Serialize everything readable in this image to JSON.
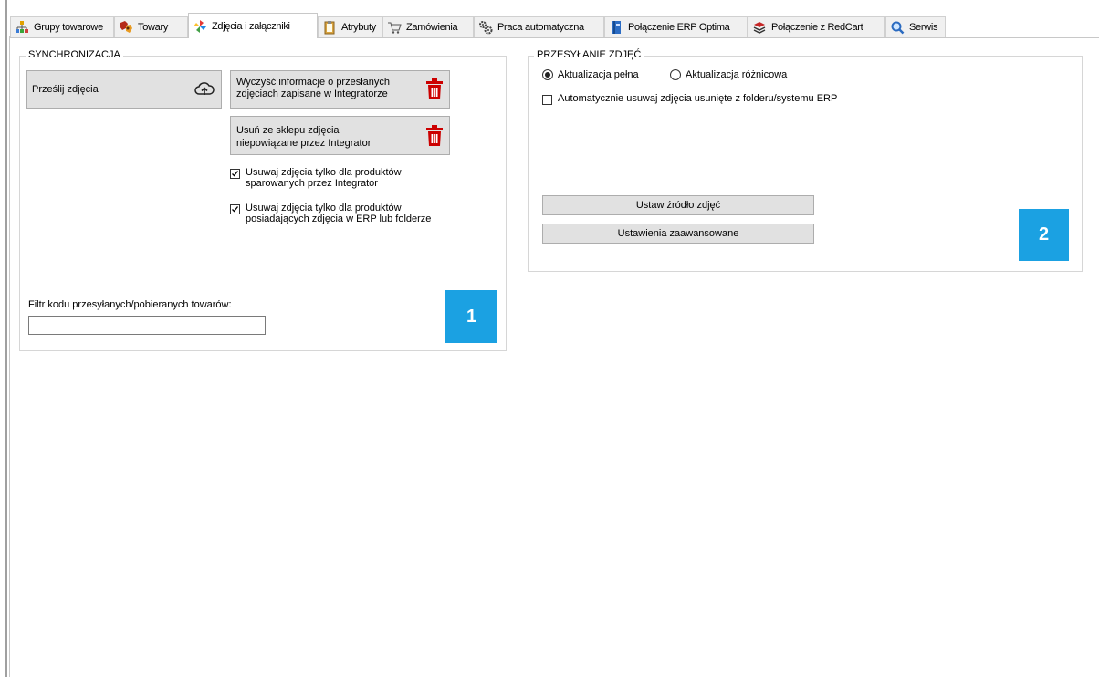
{
  "tabs": [
    {
      "label": "Grupy towarowe",
      "icon": "hierarchy-icon",
      "active": false
    },
    {
      "label": "Towary",
      "icon": "products-icon",
      "active": false
    },
    {
      "label": "Zdjęcia i załączniki",
      "icon": "pinwheel-icon",
      "active": true
    },
    {
      "label": "Atrybuty",
      "icon": "clipboard-icon",
      "active": false
    },
    {
      "label": "Zamówienia",
      "icon": "cart-icon",
      "active": false
    },
    {
      "label": "Praca automatyczna",
      "icon": "gears-icon",
      "active": false
    },
    {
      "label": "Połączenie ERP Optima",
      "icon": "book-icon",
      "active": false
    },
    {
      "label": "Połączenie z RedCart",
      "icon": "stack-icon",
      "active": false
    },
    {
      "label": "Serwis",
      "icon": "magnifier-icon",
      "active": false
    }
  ],
  "sync": {
    "legend": "SYNCHRONIZACJA",
    "upload_button": "Prześlij zdjęcia",
    "clear_button_line1": "Wyczyść informacje o przesłanych",
    "clear_button_line2": "zdjęciach zapisane w Integratorze",
    "remove_button_line1": "Usuń ze sklepu zdjęcia",
    "remove_button_line2": "niepowiązane przez Integrator",
    "check1_line1": "Usuwaj zdjęcia tylko dla produktów",
    "check1_line2": "sparowanych przez Integrator",
    "check1_checked": true,
    "check2_line1": "Usuwaj zdjęcia tylko dla produktów",
    "check2_line2": "posiadających zdjęcia w ERP lub folderze",
    "check2_checked": true,
    "filter_label": "Filtr kodu przesyłanych/pobieranych towarów:",
    "filter_value": "",
    "badge": "1"
  },
  "photos": {
    "legend": "PRZESYŁANIE ZDJĘĆ",
    "radio_full": "Aktualizacja pełna",
    "radio_diff": "Aktualizacja różnicowa",
    "selected_mode": "full",
    "auto_delete": "Automatycznie usuwaj zdjęcia usunięte z folderu/systemu ERP",
    "auto_delete_checked": false,
    "source_button": "Ustaw źródło zdjęć",
    "advanced_button": "Ustawienia zaawansowane",
    "badge": "2"
  },
  "colors": {
    "badge": "#1ba1e2",
    "trash_icon": "#cc0000"
  }
}
